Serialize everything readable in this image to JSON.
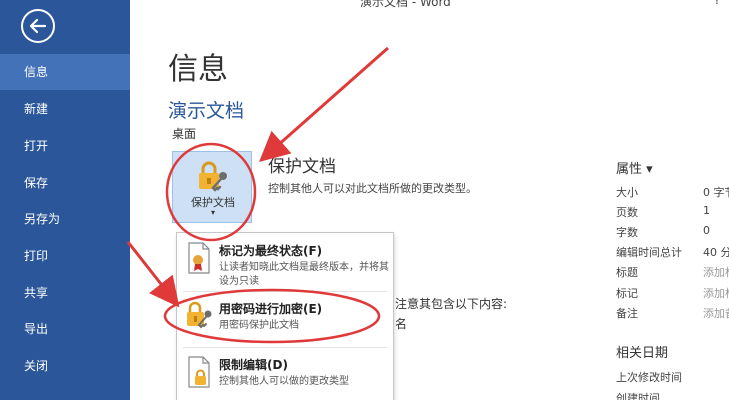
{
  "titlebar": {
    "title": "演示文档 - Word",
    "help": "?"
  },
  "sidebar": {
    "items": [
      {
        "label": "信息",
        "active": true
      },
      {
        "label": "新建"
      },
      {
        "label": "打开"
      },
      {
        "label": "保存"
      },
      {
        "label": "另存为"
      },
      {
        "label": "打印"
      },
      {
        "label": "共享"
      },
      {
        "label": "导出"
      },
      {
        "label": "关闭"
      }
    ]
  },
  "main": {
    "page_title": "信息",
    "doc_name": "演示文档",
    "doc_location": "桌面",
    "protect": {
      "tile_label": "保护文档",
      "chevron": "▾",
      "heading": "保护文档",
      "description": "控制其他人可以对此文档所做的更改类型。"
    },
    "partial_text_1": "注意其包含以下内容:",
    "partial_text_2": "名"
  },
  "dropdown": {
    "items": [
      {
        "title": "标记为最终状态(F)",
        "desc": "让读者知晓此文档是最终版本，并将其设为只读"
      },
      {
        "title": "用密码进行加密(E)",
        "desc": "用密码保护此文档"
      },
      {
        "title": "限制编辑(D)",
        "desc": "控制其他人可以做的更改类型"
      }
    ]
  },
  "properties": {
    "heading": "属性 ▾",
    "rows": [
      {
        "label": "大小",
        "value": "0 字节",
        "muted": false
      },
      {
        "label": "页数",
        "value": "1",
        "muted": false
      },
      {
        "label": "字数",
        "value": "0",
        "muted": false
      },
      {
        "label": "编辑时间总计",
        "value": "40 分",
        "muted": false
      },
      {
        "label": "标题",
        "value": "添加标题",
        "muted": true
      },
      {
        "label": "标记",
        "value": "添加标记",
        "muted": true
      },
      {
        "label": "备注",
        "value": "添加备注",
        "muted": true
      }
    ],
    "dates_heading": "相关日期",
    "date_rows": [
      {
        "label": "上次修改时间"
      },
      {
        "label": "创建时间"
      }
    ]
  },
  "colors": {
    "sidebar": "#2b579a",
    "sidebar_active": "#4472b8",
    "accent": "#2b579a",
    "annotation": "#e0393a"
  }
}
